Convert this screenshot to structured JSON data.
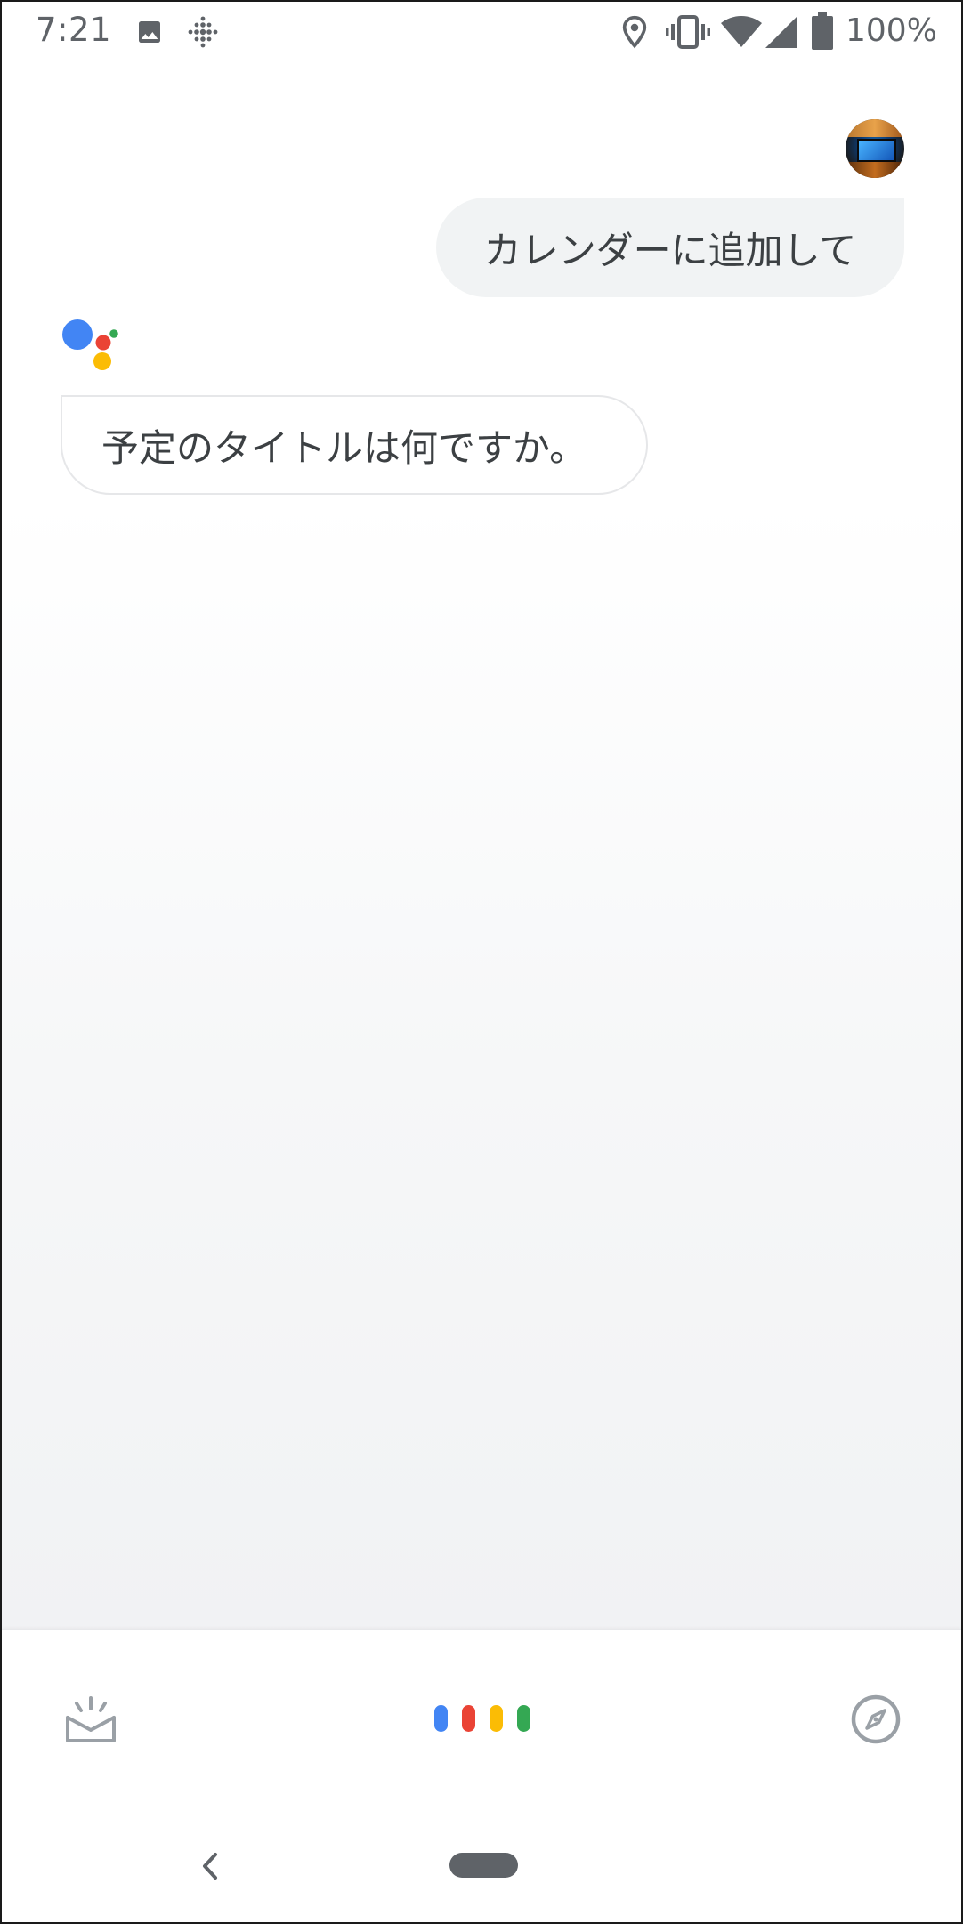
{
  "status_bar": {
    "time": "7:21",
    "battery_percent": "100%",
    "icons": [
      "image-icon",
      "fitbit-icon",
      "location-icon",
      "vibrate-icon",
      "wifi-icon",
      "signal-icon",
      "battery-icon"
    ]
  },
  "chat": {
    "user_message": "カレンダーに追加して",
    "assistant_message": "予定のタイトルは何ですか。"
  },
  "bottom_bar": {
    "left_icon": "snapshot-icon",
    "center_icon": "assistant-mic-dots",
    "right_icon": "explore-compass-icon",
    "mic_dot_colors": [
      "#4285F4",
      "#EA4335",
      "#FBBC05",
      "#34A853"
    ]
  },
  "nav_bar": {
    "icons": [
      "back-icon",
      "home-pill"
    ]
  },
  "colors": {
    "assistant_blue": "#4285F4",
    "assistant_red": "#EA4335",
    "assistant_yellow": "#FBBC05",
    "assistant_green": "#34A853",
    "icon_gray": "#5f6368",
    "user_bubble_bg": "#f1f3f4"
  }
}
